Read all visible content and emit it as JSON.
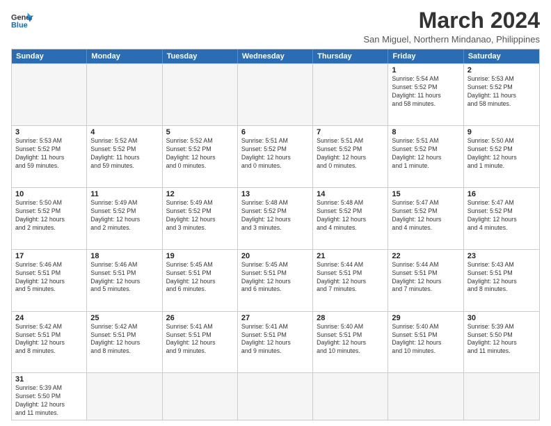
{
  "header": {
    "logo_line1": "General",
    "logo_line2": "Blue",
    "title": "March 2024",
    "subtitle": "San Miguel, Northern Mindanao, Philippines"
  },
  "days_of_week": [
    "Sunday",
    "Monday",
    "Tuesday",
    "Wednesday",
    "Thursday",
    "Friday",
    "Saturday"
  ],
  "weeks": [
    [
      {
        "day": "",
        "info": "",
        "empty": true
      },
      {
        "day": "",
        "info": "",
        "empty": true
      },
      {
        "day": "",
        "info": "",
        "empty": true
      },
      {
        "day": "",
        "info": "",
        "empty": true
      },
      {
        "day": "",
        "info": "",
        "empty": true
      },
      {
        "day": "1",
        "info": "Sunrise: 5:54 AM\nSunset: 5:52 PM\nDaylight: 11 hours\nand 58 minutes."
      },
      {
        "day": "2",
        "info": "Sunrise: 5:53 AM\nSunset: 5:52 PM\nDaylight: 11 hours\nand 58 minutes."
      }
    ],
    [
      {
        "day": "3",
        "info": "Sunrise: 5:53 AM\nSunset: 5:52 PM\nDaylight: 11 hours\nand 59 minutes."
      },
      {
        "day": "4",
        "info": "Sunrise: 5:52 AM\nSunset: 5:52 PM\nDaylight: 11 hours\nand 59 minutes."
      },
      {
        "day": "5",
        "info": "Sunrise: 5:52 AM\nSunset: 5:52 PM\nDaylight: 12 hours\nand 0 minutes."
      },
      {
        "day": "6",
        "info": "Sunrise: 5:51 AM\nSunset: 5:52 PM\nDaylight: 12 hours\nand 0 minutes."
      },
      {
        "day": "7",
        "info": "Sunrise: 5:51 AM\nSunset: 5:52 PM\nDaylight: 12 hours\nand 0 minutes."
      },
      {
        "day": "8",
        "info": "Sunrise: 5:51 AM\nSunset: 5:52 PM\nDaylight: 12 hours\nand 1 minute."
      },
      {
        "day": "9",
        "info": "Sunrise: 5:50 AM\nSunset: 5:52 PM\nDaylight: 12 hours\nand 1 minute."
      }
    ],
    [
      {
        "day": "10",
        "info": "Sunrise: 5:50 AM\nSunset: 5:52 PM\nDaylight: 12 hours\nand 2 minutes."
      },
      {
        "day": "11",
        "info": "Sunrise: 5:49 AM\nSunset: 5:52 PM\nDaylight: 12 hours\nand 2 minutes."
      },
      {
        "day": "12",
        "info": "Sunrise: 5:49 AM\nSunset: 5:52 PM\nDaylight: 12 hours\nand 3 minutes."
      },
      {
        "day": "13",
        "info": "Sunrise: 5:48 AM\nSunset: 5:52 PM\nDaylight: 12 hours\nand 3 minutes."
      },
      {
        "day": "14",
        "info": "Sunrise: 5:48 AM\nSunset: 5:52 PM\nDaylight: 12 hours\nand 4 minutes."
      },
      {
        "day": "15",
        "info": "Sunrise: 5:47 AM\nSunset: 5:52 PM\nDaylight: 12 hours\nand 4 minutes."
      },
      {
        "day": "16",
        "info": "Sunrise: 5:47 AM\nSunset: 5:52 PM\nDaylight: 12 hours\nand 4 minutes."
      }
    ],
    [
      {
        "day": "17",
        "info": "Sunrise: 5:46 AM\nSunset: 5:51 PM\nDaylight: 12 hours\nand 5 minutes."
      },
      {
        "day": "18",
        "info": "Sunrise: 5:46 AM\nSunset: 5:51 PM\nDaylight: 12 hours\nand 5 minutes."
      },
      {
        "day": "19",
        "info": "Sunrise: 5:45 AM\nSunset: 5:51 PM\nDaylight: 12 hours\nand 6 minutes."
      },
      {
        "day": "20",
        "info": "Sunrise: 5:45 AM\nSunset: 5:51 PM\nDaylight: 12 hours\nand 6 minutes."
      },
      {
        "day": "21",
        "info": "Sunrise: 5:44 AM\nSunset: 5:51 PM\nDaylight: 12 hours\nand 7 minutes."
      },
      {
        "day": "22",
        "info": "Sunrise: 5:44 AM\nSunset: 5:51 PM\nDaylight: 12 hours\nand 7 minutes."
      },
      {
        "day": "23",
        "info": "Sunrise: 5:43 AM\nSunset: 5:51 PM\nDaylight: 12 hours\nand 8 minutes."
      }
    ],
    [
      {
        "day": "24",
        "info": "Sunrise: 5:42 AM\nSunset: 5:51 PM\nDaylight: 12 hours\nand 8 minutes."
      },
      {
        "day": "25",
        "info": "Sunrise: 5:42 AM\nSunset: 5:51 PM\nDaylight: 12 hours\nand 8 minutes."
      },
      {
        "day": "26",
        "info": "Sunrise: 5:41 AM\nSunset: 5:51 PM\nDaylight: 12 hours\nand 9 minutes."
      },
      {
        "day": "27",
        "info": "Sunrise: 5:41 AM\nSunset: 5:51 PM\nDaylight: 12 hours\nand 9 minutes."
      },
      {
        "day": "28",
        "info": "Sunrise: 5:40 AM\nSunset: 5:51 PM\nDaylight: 12 hours\nand 10 minutes."
      },
      {
        "day": "29",
        "info": "Sunrise: 5:40 AM\nSunset: 5:51 PM\nDaylight: 12 hours\nand 10 minutes."
      },
      {
        "day": "30",
        "info": "Sunrise: 5:39 AM\nSunset: 5:50 PM\nDaylight: 12 hours\nand 11 minutes."
      }
    ],
    [
      {
        "day": "31",
        "info": "Sunrise: 5:39 AM\nSunset: 5:50 PM\nDaylight: 12 hours\nand 11 minutes."
      },
      {
        "day": "",
        "info": "",
        "empty": true
      },
      {
        "day": "",
        "info": "",
        "empty": true
      },
      {
        "day": "",
        "info": "",
        "empty": true
      },
      {
        "day": "",
        "info": "",
        "empty": true
      },
      {
        "day": "",
        "info": "",
        "empty": true
      },
      {
        "day": "",
        "info": "",
        "empty": true
      }
    ]
  ]
}
